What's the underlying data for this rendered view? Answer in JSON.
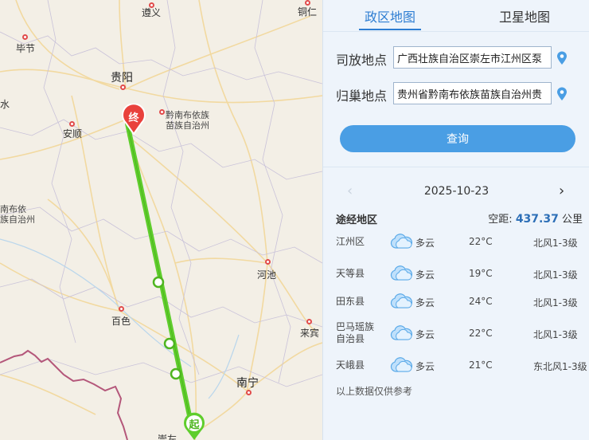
{
  "map": {
    "cities": [
      {
        "name": "遵义",
        "label": "遵义"
      },
      {
        "name": "铜仁",
        "label": "铜仁"
      },
      {
        "name": "毕节",
        "label": "毕节"
      },
      {
        "name": "贵阳",
        "label": "贵阳"
      },
      {
        "name": "黔南布依族苗族自治州",
        "label": "黔南布依族苗族自治州"
      },
      {
        "name": "安顺",
        "label": "安顺"
      },
      {
        "name": "河池",
        "label": "河池"
      },
      {
        "name": "百色",
        "label": "百色"
      },
      {
        "name": "来宾",
        "label": "来宾"
      },
      {
        "name": "南宁",
        "label": "南宁"
      }
    ],
    "partial_labels": {
      "left_water": "水",
      "left_qianxinan": "南布依\n族自治州",
      "bottom_chongzuo": "崇左"
    },
    "markers": {
      "start": "起",
      "end": "终"
    },
    "route_color": "#5fcd2c"
  },
  "tabs": [
    {
      "label": "政区地图",
      "active": true
    },
    {
      "label": "卫星地图",
      "active": false
    }
  ],
  "form": {
    "origin_label": "司放地点",
    "origin_value": "广西壮族自治区崇左市江州区泵",
    "dest_label": "归巢地点",
    "dest_value": "贵州省黔南布依族苗族自治州贵",
    "query_label": "查询"
  },
  "date": "2025-10-23",
  "route_section": {
    "title": "途经地区",
    "distance_label": "空距:",
    "distance_value": "437.37",
    "distance_unit": "公里"
  },
  "weather": [
    {
      "region": "江州区",
      "condition": "多云",
      "temp": "22°C",
      "wind": "北风1-3级",
      "icon": "cloud-icon"
    },
    {
      "region": "天等县",
      "condition": "多云",
      "temp": "19°C",
      "wind": "北风1-3级",
      "icon": "cloud-icon"
    },
    {
      "region": "田东县",
      "condition": "多云",
      "temp": "24°C",
      "wind": "北风1-3级",
      "icon": "cloud-icon"
    },
    {
      "region": "巴马瑶族自治县",
      "condition": "多云",
      "temp": "22°C",
      "wind": "北风1-3级",
      "icon": "cloud-icon"
    },
    {
      "region": "天峨县",
      "condition": "多云",
      "temp": "21°C",
      "wind": "东北风1-3级",
      "icon": "cloud-icon"
    }
  ],
  "footnote": "以上数据仅供参考"
}
